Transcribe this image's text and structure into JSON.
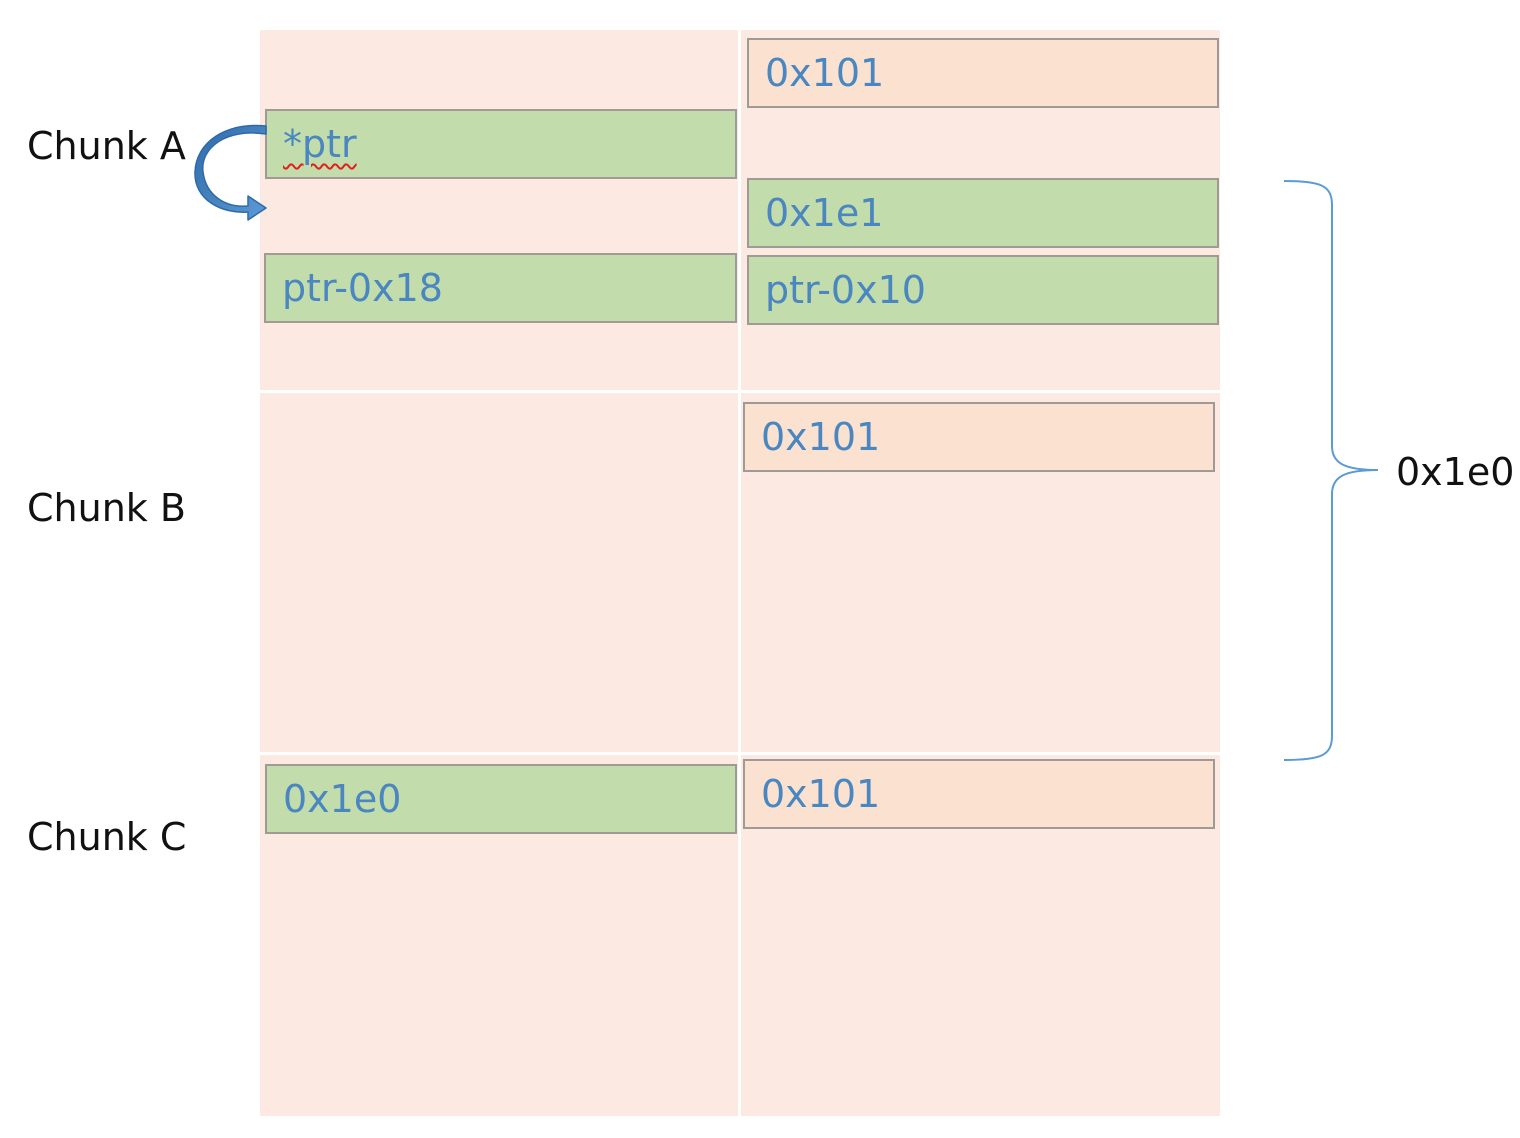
{
  "chunks": {
    "a": {
      "label": "Chunk A"
    },
    "b": {
      "label": "Chunk B"
    },
    "c": {
      "label": "Chunk C"
    }
  },
  "cells": {
    "a_prev_size": "0x101",
    "a_ptr": "*ptr",
    "a_size": "0x1e1",
    "a_fd": "ptr-0x18",
    "a_bk": "ptr-0x10",
    "b_size": "0x101",
    "c_prev_size": "0x1e0",
    "c_size": "0x101"
  },
  "brace": {
    "label": "0x1e0"
  },
  "colors": {
    "region": "#fce9e2",
    "green_cell": "#c2dcab",
    "peach_cell": "#fbe1d0",
    "cell_text": "#4a86c0",
    "arrow": "#3f78b8",
    "brace": "#5b9bd5"
  }
}
